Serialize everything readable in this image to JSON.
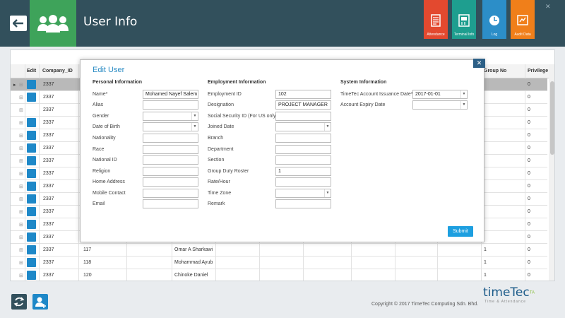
{
  "header": {
    "title": "User Info",
    "tiles": [
      {
        "label": "Attendance"
      },
      {
        "label": "Terminal Info"
      },
      {
        "label": "Log"
      },
      {
        "label": "Audit Data"
      }
    ]
  },
  "table": {
    "columns": [
      "Edit",
      "Company_ID",
      "Group No",
      "Privilege"
    ],
    "company_id": "2337",
    "privilege": "0",
    "rows_bottom": [
      {
        "user_id": "117",
        "name": "Omar A Sharkawi",
        "group": "1",
        "privilege": "0"
      },
      {
        "user_id": "118",
        "name": "Mohammad Ayub",
        "group": "1",
        "privilege": "0"
      },
      {
        "user_id": "120",
        "name": "Chinoke Daniel",
        "group": "1",
        "privilege": "0"
      }
    ]
  },
  "modal": {
    "title": "Edit User",
    "personal": {
      "heading": "Personal Information",
      "name_label": "Name*",
      "name_value": "Mohamed Nayef Salem",
      "alias_label": "Alias",
      "gender_label": "Gender",
      "dob_label": "Date of Birth",
      "nationality_label": "Nationality",
      "race_label": "Race",
      "national_id_label": "National ID",
      "religion_label": "Religion",
      "address_label": "Home Address",
      "mobile_label": "Mobile Contact",
      "email_label": "Email"
    },
    "employment": {
      "heading": "Employment Information",
      "emp_id_label": "Employment ID",
      "emp_id_value": "102",
      "designation_label": "Designation",
      "designation_value": "PROJECT MANAGER",
      "ssid_label": "Social Security ID (For US only)",
      "joined_label": "Joined Date",
      "branch_label": "Branch",
      "department_label": "Department",
      "section_label": "Section",
      "roster_label": "Group Duty Roster",
      "roster_value": "1",
      "rate_label": "Rate/Hour",
      "timezone_label": "Time Zone",
      "remark_label": "Remark"
    },
    "system": {
      "heading": "System Information",
      "issuance_label": "TimeTec Account Issuance Date*",
      "issuance_value": "2017-01-01",
      "expiry_label": "Account Expiry Date"
    },
    "submit_label": "Submit",
    "close_label": "✕"
  },
  "footer": {
    "copyright": "Copyright © 2017 TimeTec Computing Sdn. Bhd.",
    "logo_text": "timeTec",
    "logo_sup": "TA",
    "logo_sub": "Time & Attendance"
  },
  "colors": {
    "header": "#32505c",
    "users_tile": "#3ea35a",
    "attendance": "#e3492f",
    "terminal": "#1e9e8f",
    "log": "#2c8ec8",
    "audit": "#f07f1a",
    "accent": "#1d9fe0"
  }
}
